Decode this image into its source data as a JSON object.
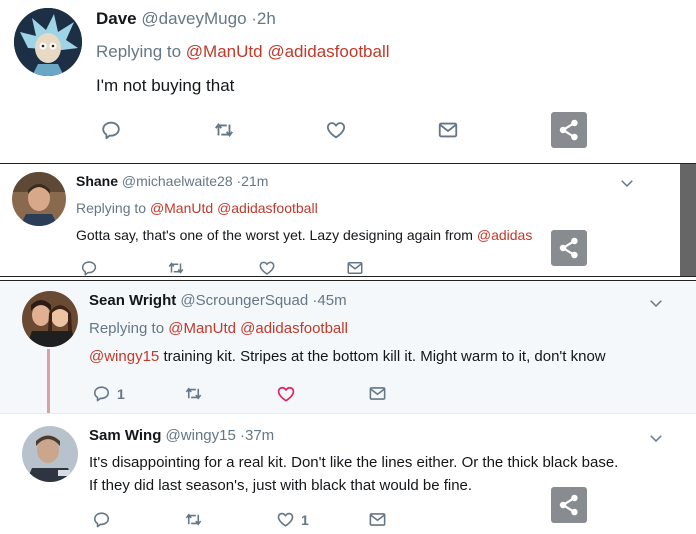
{
  "tweet1": {
    "name": "Dave",
    "handle": "@daveyMugo",
    "time": "·2h",
    "replying_to_label": "Replying to",
    "mention1": "@ManUtd",
    "mention2": "@adidasfootball",
    "text": "I'm not buying that"
  },
  "tweet2": {
    "name": "Shane",
    "handle": "@michaelwaite28",
    "time": "·21m",
    "replying_to_label": "Replying to",
    "mention1": "@ManUtd",
    "mention2": "@adidasfootball",
    "text": "Gotta say, that's one of the worst yet. Lazy designing again from",
    "text_mention": "@adidas"
  },
  "tweet3": {
    "name": "Sean Wright",
    "handle": "@ScroungerSquad",
    "time": "·45m",
    "replying_to_label": "Replying to",
    "mention1": "@ManUtd",
    "mention2": "@adidasfootball",
    "text_mention": "@wingy15",
    "text": "training kit.  Stripes at the bottom kill it. Might warm to it, don't know",
    "reply_count": "1"
  },
  "tweet4": {
    "name": "Sam Wing",
    "handle": "@wingy15",
    "time": "·37m",
    "text_line1": "It's disappointing for a real kit. Don't like the lines either. Or the thick black base.",
    "text_line2": "If they did last season's, just with black that would be fine.",
    "like_count": "1"
  },
  "icons": {
    "reply": "reply-icon",
    "retweet": "retweet-icon",
    "like": "heart-icon",
    "dm": "envelope-icon",
    "share": "share-icon",
    "more": "chevron-down-icon"
  },
  "colors": {
    "mention": "#c0392b",
    "muted": "#657786",
    "liked_heart": "#e0245e",
    "thread_line": "#d9a0a8",
    "share_bg": "#888b8f"
  }
}
